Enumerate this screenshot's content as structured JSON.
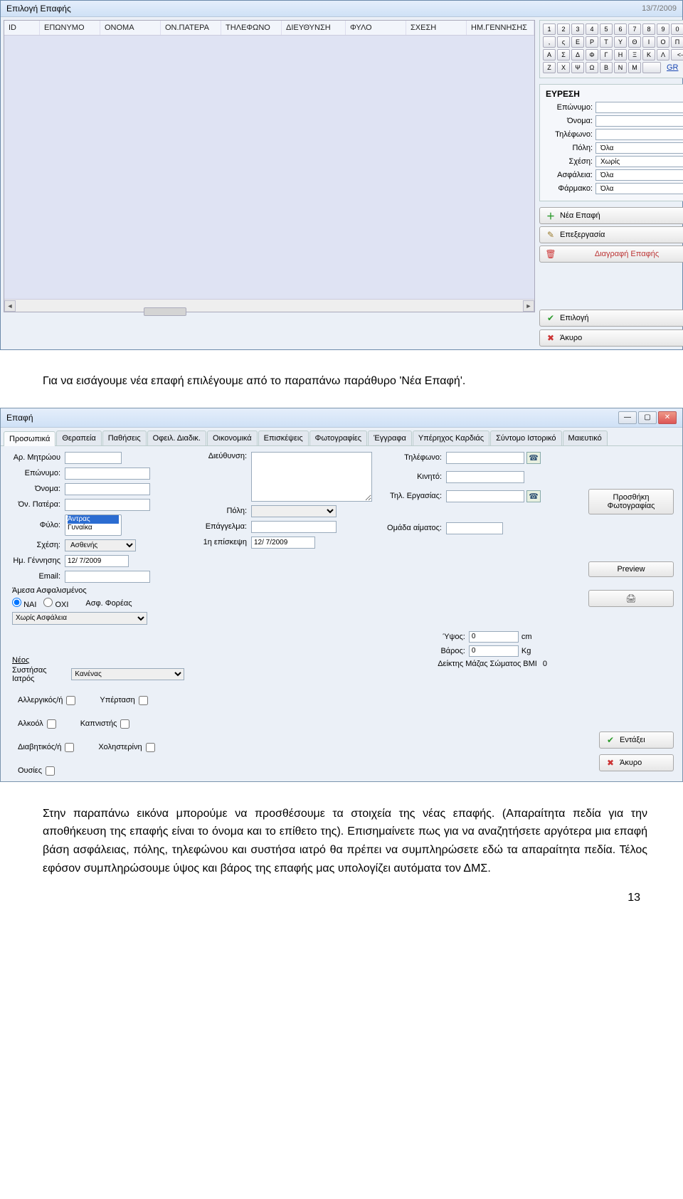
{
  "win1": {
    "title": "Επιλογή Επαφής",
    "date": "13/7/2009",
    "columns": [
      "ID",
      "ΕΠΩΝΥΜΟ",
      "ΟΝΟΜΑ",
      "ΟΝ.ΠΑΤΕΡΑ",
      "ΤΗΛΕΦΩΝΟ",
      "ΔΙΕΥΘΥΝΣΗ",
      "ΦΥΛΟ",
      "ΣΧΕΣΗ",
      "ΗΜ.ΓΕΝΝΗΣΗΣ"
    ],
    "keypad": {
      "r1": [
        "1",
        "2",
        "3",
        "4",
        "5",
        "6",
        "7",
        "8",
        "9",
        "0"
      ],
      "r2": [
        ",",
        "ς",
        "Ε",
        "Ρ",
        "Τ",
        "Υ",
        "Θ",
        "Ι",
        "Ο",
        "Π"
      ],
      "r3": [
        "Α",
        "Σ",
        "Δ",
        "Φ",
        "Γ",
        "Η",
        "Ξ",
        "Κ",
        "Λ",
        "<-"
      ],
      "r4": [
        "Ζ",
        "Χ",
        "Ψ",
        "Ω",
        "Β",
        "Ν",
        "Μ"
      ],
      "gr": "GR"
    },
    "search": {
      "heading": "ΕΥΡΕΣΗ",
      "lastname_label": "Επώνυμο:",
      "firstname_label": "Όνομα:",
      "phone_label": "Τηλέφωνο:",
      "city_label": "Πόλη:",
      "city_value": "Όλα",
      "relation_label": "Σχέση:",
      "relation_value": "Χωρίς",
      "insurance_label": "Ασφάλεια:",
      "insurance_value": "Όλα",
      "drug_label": "Φάρμακο:",
      "drug_value": "Όλα"
    },
    "buttons": {
      "new": "Νέα Επαφή",
      "edit": "Επεξεργασία",
      "delete": "Διαγραφή Επαφής",
      "select": "Επιλογή",
      "cancel": "Άκυρο"
    }
  },
  "para1": "Για να εισάγουμε νέα επαφή επιλέγουμε από το παραπάνω παράθυρο 'Νέα Επαφή'.",
  "win2": {
    "title": "Επαφή",
    "tabs": [
      "Προσωπικά",
      "Θεραπεία",
      "Παθήσεις",
      "Οφειλ. Διαδικ.",
      "Οικονομικά",
      "Επισκέψεις",
      "Φωτογραφίες",
      "Έγγραφα",
      "Υπέρηχος Καρδιάς",
      "Σύντομο Ιστορικό",
      "Μαιευτικό"
    ],
    "labels": {
      "regno": "Αρ. Μητρώου",
      "lastname": "Επώνυμο:",
      "firstname": "Όνομα:",
      "fathername": "Όν. Πατέρα:",
      "sex": "Φύλο:",
      "sex_male": "Άντρας",
      "sex_female": "Γυναίκα",
      "relation": "Σχέση:",
      "relation_value": "Ασθενής",
      "birth": "Ημ. Γέννησης",
      "birth_value": "12/ 7/2009",
      "email": "Email:",
      "address": "Διεύθυνση:",
      "city": "Πόλη:",
      "occupation": "Επάγγελμα:",
      "firstvisit": "1η επίσκεψη",
      "firstvisit_value": "12/ 7/2009",
      "phone": "Τηλέφωνο:",
      "mobile": "Κινητό:",
      "workphone": "Τηλ. Εργασίας:",
      "blood": "Ομάδα αίματος:",
      "insured_header": "Άμεσα Ασφαλισμένος",
      "yes": "ΝΑΙ",
      "no": "ΟΧΙ",
      "ins_body": "Ασφ. Φορέας",
      "ins_value": "Χωρίς Ασφάλεια",
      "neos": "Νέος",
      "doctor": "Συστήσας Ιατρός",
      "doctor_value": "Κανένας",
      "addphoto": "Προσθήκη Φωτογραφίας",
      "preview": "Preview",
      "height": "Ύψος:",
      "height_value": "0",
      "height_unit": "cm",
      "weight": "Βάρος:",
      "weight_value": "0",
      "weight_unit": "Kg",
      "bmi_label": "Δείκτης Μάζας Σώματος BMI",
      "bmi_value": "0",
      "ok": "Εντάξει",
      "cancel": "Άκυρο"
    },
    "checks": {
      "allergic": "Αλλεργικός/ή",
      "hypertension": "Υπέρταση",
      "alcohol": "Αλκοόλ",
      "smoker": "Καπνιστής",
      "diabetic": "Διαβητικός/ή",
      "cholesterol": "Χοληστερίνη",
      "drugs": "Ουσίες"
    }
  },
  "para2": "Στην παραπάνω εικόνα μπορούμε να προσθέσουμε τα στοιχεία της νέας επαφής. (Απαραίτητα πεδία για την αποθήκευση της επαφής είναι το όνομα και το επίθετο της). Επισημαίνετε πως για να αναζητήσετε αργότερα μια επαφή βάση ασφάλειας, πόλης, τηλεφώνου και συστήσα ιατρό θα πρέπει να συμπληρώσετε εδώ τα απαραίτητα πεδία. Τέλος εφόσον συμπληρώσουμε ύψος και βάρος της επαφής μας υπολογίζει αυτόματα τον ΔΜΣ.",
  "pagenum": "13"
}
